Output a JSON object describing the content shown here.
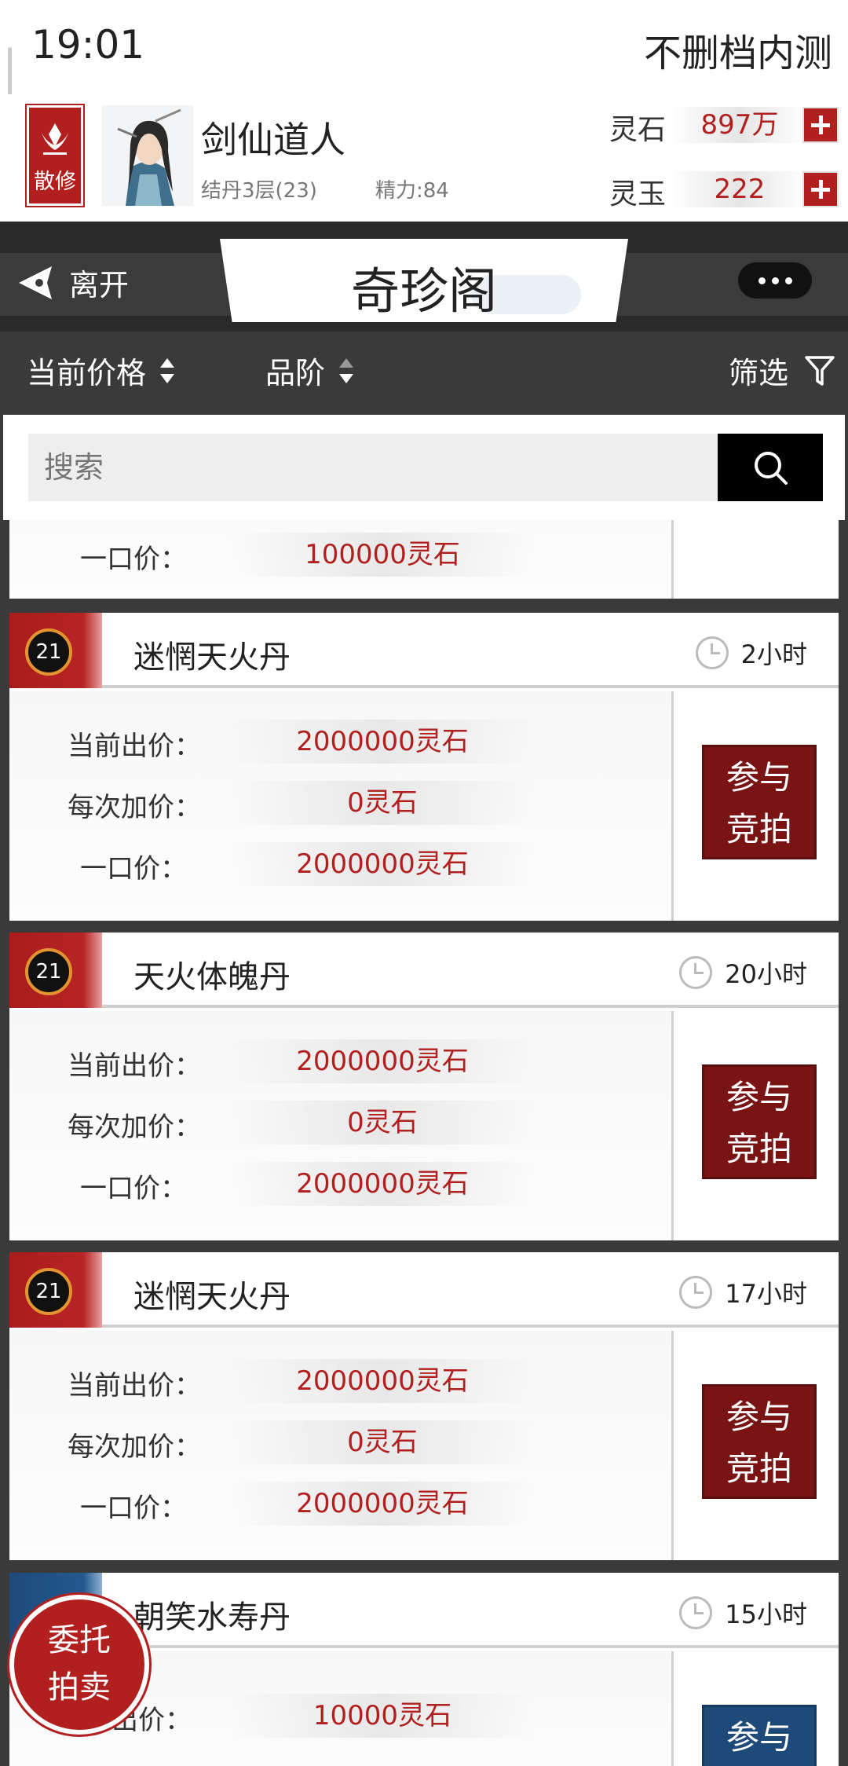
{
  "status": {
    "time": "19:01",
    "title": "不删档内测"
  },
  "player": {
    "sect": "散修",
    "name": "剑仙道人",
    "realm": "结丹3层(23)",
    "energy": "精力:84",
    "spirit_stone_label": "灵石",
    "spirit_stone_value": "897万",
    "spirit_jade_label": "灵玉",
    "spirit_jade_value": "222"
  },
  "nav": {
    "leave_label": "离开",
    "title": "奇珍阁"
  },
  "sort": {
    "price_label": "当前价格",
    "grade_label": "品阶",
    "filter_label": "筛选"
  },
  "search": {
    "placeholder": "搜索"
  },
  "partial_card": {
    "buyout_label": "一口价：",
    "buyout_value": "100000灵石"
  },
  "cards": [
    {
      "grade": "21",
      "name": "迷惘天火丹",
      "time": "2小时",
      "current_label": "当前出价：",
      "current": "2000000灵石",
      "increment_label": "每次加价：",
      "increment": "0灵石",
      "buyout_label": "一口价：",
      "buyout": "2000000灵石",
      "button": "参与竞拍",
      "button_l1": "参与",
      "button_l2": "竞拍"
    },
    {
      "grade": "21",
      "name": "天火体魄丹",
      "time": "20小时",
      "current_label": "当前出价：",
      "current": "2000000灵石",
      "increment_label": "每次加价：",
      "increment": "0灵石",
      "buyout_label": "一口价：",
      "buyout": "2000000灵石",
      "button_l1": "参与",
      "button_l2": "竞拍"
    },
    {
      "grade": "21",
      "name": "迷惘天火丹",
      "time": "17小时",
      "current_label": "当前出价：",
      "current": "2000000灵石",
      "increment_label": "每次加价：",
      "increment": "0灵石",
      "buyout_label": "一口价：",
      "buyout": "2000000灵石",
      "button_l1": "参与",
      "button_l2": "竞拍"
    },
    {
      "name": "朝笑水寿丹",
      "time": "15小时",
      "current_label_partial": "出价：",
      "current": "10000灵石",
      "button_l1": "参与"
    }
  ],
  "fab": {
    "line1": "委托",
    "line2": "拍卖"
  },
  "colors": {
    "accent_red": "#b1201f",
    "dark_red": "#7a1414",
    "blue": "#1e4a7a"
  }
}
